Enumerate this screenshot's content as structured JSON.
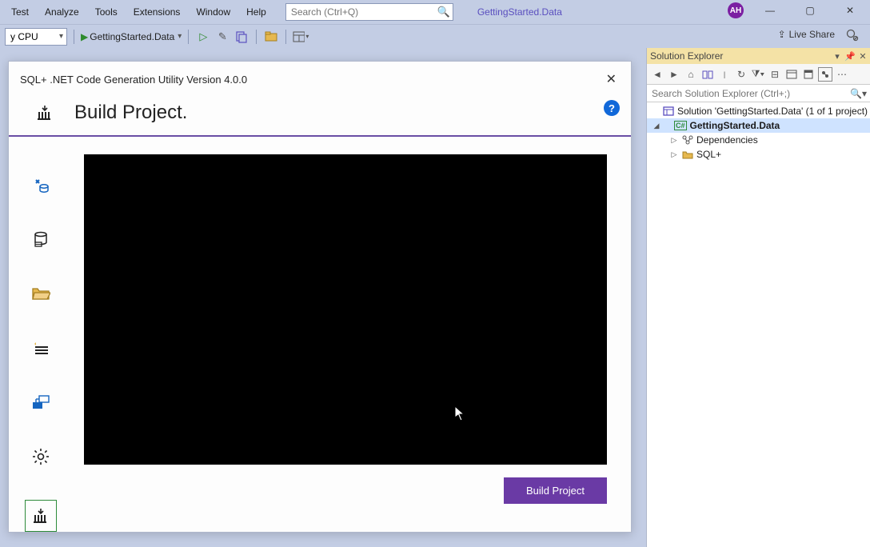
{
  "menu": {
    "items": [
      "Test",
      "Analyze",
      "Tools",
      "Extensions",
      "Window",
      "Help"
    ]
  },
  "search": {
    "placeholder": "Search (Ctrl+Q)"
  },
  "projectName": "GettingStarted.Data",
  "avatar": "AH",
  "toolbar": {
    "config": "y CPU",
    "runTarget": "GettingStarted.Data",
    "liveShare": "Live Share"
  },
  "dialog": {
    "title": "SQL+ .NET Code Generation Utility Version 4.0.0",
    "heading": "Build Project.",
    "help": "?",
    "buildButton": "Build Project"
  },
  "solutionExplorer": {
    "title": "Solution Explorer",
    "searchPlaceholder": "Search Solution Explorer (Ctrl+;)",
    "solutionLabel": "Solution 'GettingStarted.Data' (1 of 1 project)",
    "projectLabel": "GettingStarted.Data",
    "nodes": {
      "dependencies": "Dependencies",
      "sqlplus": "SQL+"
    }
  },
  "winControls": {
    "min": "—",
    "max": "▢",
    "close": "✕"
  }
}
